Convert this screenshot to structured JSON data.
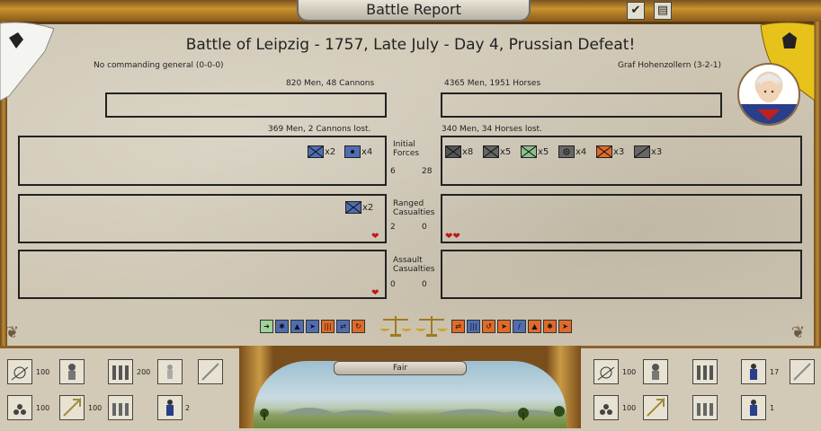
{
  "window": {
    "title": "Battle Report",
    "buttons": [
      "✔",
      "▤"
    ]
  },
  "battle": {
    "title": "Battle of Leipzig - 1757, Late July - Day 4, Prussian Defeat!"
  },
  "left": {
    "general": "No commanding general (0-0-0)",
    "strength": "820 Men, 48 Cannons",
    "losses": "369 Men, 2 Cannons lost.",
    "initial_units": [
      {
        "icon": "infantry-icon",
        "count": "x2"
      },
      {
        "icon": "artillery-icon",
        "count": "x4"
      }
    ],
    "ranged_units": [
      {
        "icon": "infantry-icon",
        "count": "x2"
      }
    ],
    "ranged_hearts": "❤",
    "assault_hearts": "❤"
  },
  "right": {
    "general": "Graf Hohenzollern (3-2-1)",
    "strength": "4365 Men, 1951 Horses",
    "losses": "340 Men, 34 Horses lost.",
    "initial_units": [
      {
        "icon": "infantry-icon",
        "count": "x8"
      },
      {
        "icon": "infantry-icon",
        "count": "x5"
      },
      {
        "icon": "light-infantry-icon",
        "count": "x5"
      },
      {
        "icon": "artillery-icon",
        "count": "x4"
      },
      {
        "icon": "cavalry-icon",
        "count": "x3"
      },
      {
        "icon": "cavalry-icon",
        "count": "x3"
      }
    ],
    "ranged_hearts": "❤❤"
  },
  "middle": {
    "initial_label": "Initial\nForces",
    "initial_left": "6",
    "initial_right": "28",
    "ranged_label": "Ranged\nCasualties",
    "ranged_left": "2",
    "ranged_right": "0",
    "assault_label": "Assault\nCasualties",
    "assault_left": "0",
    "assault_right": "0"
  },
  "weather": {
    "label": "Fair"
  },
  "bottom_left": {
    "row1": [
      "100",
      "",
      "200",
      "",
      ""
    ],
    "row2": [
      "100",
      "100",
      "",
      "2"
    ]
  },
  "bottom_right": {
    "row1": [
      "100",
      "",
      "",
      "17",
      ""
    ],
    "row2": [
      "100",
      "",
      "",
      "1"
    ]
  },
  "colors": {
    "prussia_blue": "#4f6db0",
    "enemy_orange": "#e06a2a",
    "parchment": "#cfc7b4",
    "gold": "#c8922f"
  }
}
